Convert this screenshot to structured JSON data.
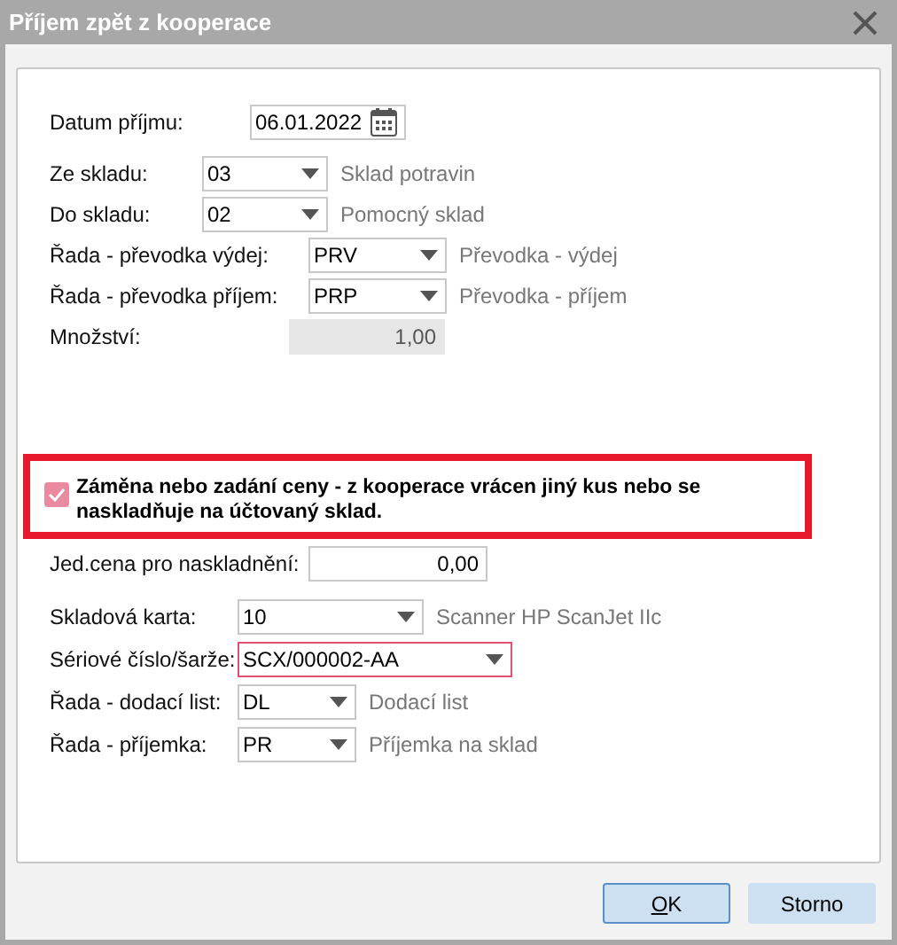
{
  "window": {
    "title": "Příjem zpět z kooperace"
  },
  "top_fields": [
    {
      "kind": "date",
      "label": "Datum příjmu:",
      "value": "06.01.2022"
    },
    {
      "kind": "combo",
      "label": "Ze skladu:",
      "value": "03",
      "description": "Sklad potravin"
    },
    {
      "kind": "combo",
      "label": "Do skladu:",
      "value": "02",
      "description": "Pomocný sklad"
    },
    {
      "kind": "combo",
      "label": "Řada - převodka výdej:",
      "value": "PRV",
      "description": "Převodka - výdej"
    },
    {
      "kind": "combo",
      "label": "Řada - převodka příjem:",
      "value": "PRP",
      "description": "Převodka - příjem"
    },
    {
      "kind": "number",
      "label": "Množství:",
      "value": "1,00",
      "disabled": true
    }
  ],
  "option": {
    "label": "Záměna nebo zadání ceny - z kooperace vrácen jiný kus nebo se naskladňuje na účtovaný sklad.",
    "checked": true,
    "highlighted": true
  },
  "bottom_fields": [
    {
      "kind": "number",
      "label": "Jed.cena pro naskladnění:",
      "value": "0,00",
      "disabled": false
    },
    {
      "kind": "combo",
      "label": "Skladová karta:",
      "value": "10",
      "description": "Scanner HP ScanJet IIc"
    },
    {
      "kind": "combo",
      "label": "Sériové číslo/šarže:",
      "value": "SCX/000002-AA",
      "invalid": true
    },
    {
      "kind": "combo",
      "label": "Řada - dodací list:",
      "value": "DL",
      "description": "Dodací list"
    },
    {
      "kind": "combo",
      "label": "Řada - příjemka:",
      "value": "PR",
      "description": "Příjemka na sklad"
    }
  ],
  "buttons": [
    {
      "label": "OK",
      "underline_first": true,
      "default": true
    },
    {
      "label": "Storno",
      "default": false
    }
  ]
}
